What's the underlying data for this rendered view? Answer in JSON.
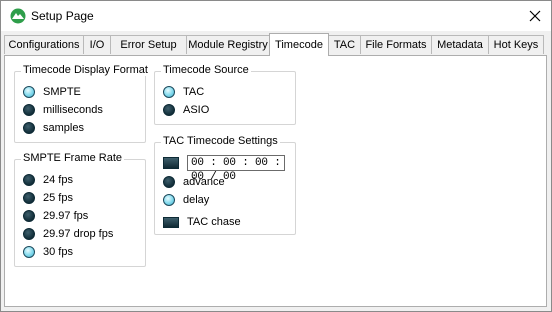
{
  "window": {
    "title": "Setup Page",
    "close_glyph": "✕",
    "app_icon": "green-app-logo-icon"
  },
  "tabs": [
    {
      "label": "Configurations",
      "active": false
    },
    {
      "label": "I/O",
      "active": false
    },
    {
      "label": "Error Setup",
      "active": false
    },
    {
      "label": "Module Registry",
      "active": false
    },
    {
      "label": "Timecode",
      "active": true
    },
    {
      "label": "TAC",
      "active": false
    },
    {
      "label": "File Formats",
      "active": false
    },
    {
      "label": "Metadata",
      "active": false
    },
    {
      "label": "Hot Keys",
      "active": false
    }
  ],
  "display_format": {
    "title": "Timecode Display Format",
    "options": [
      {
        "label": "SMPTE",
        "selected": true
      },
      {
        "label": "milliseconds",
        "selected": false
      },
      {
        "label": "samples",
        "selected": false
      }
    ]
  },
  "frame_rate": {
    "title": "SMPTE Frame Rate",
    "options": [
      {
        "label": "24 fps",
        "selected": false
      },
      {
        "label": "25 fps",
        "selected": false
      },
      {
        "label": "29.97 fps",
        "selected": false
      },
      {
        "label": "29.97 drop fps",
        "selected": false
      },
      {
        "label": "30 fps",
        "selected": true
      }
    ]
  },
  "source": {
    "title": "Timecode Source",
    "options": [
      {
        "label": "TAC",
        "selected": true
      },
      {
        "label": "ASIO",
        "selected": false
      }
    ]
  },
  "tac_settings": {
    "title": "TAC Timecode Settings",
    "timecode_value": "00 : 00 : 00 : 00 / 00",
    "options": [
      {
        "label": "advance",
        "selected": false
      },
      {
        "label": "delay",
        "selected": true
      }
    ],
    "chase_label": "TAC chase",
    "chase_on": false
  },
  "colors": {
    "led_on": "#7fd8ec",
    "led_off": "#173440",
    "panel_bg": "#ffffff",
    "window_bg": "#f0f0f0",
    "logo_green": "#2e9e4a"
  }
}
